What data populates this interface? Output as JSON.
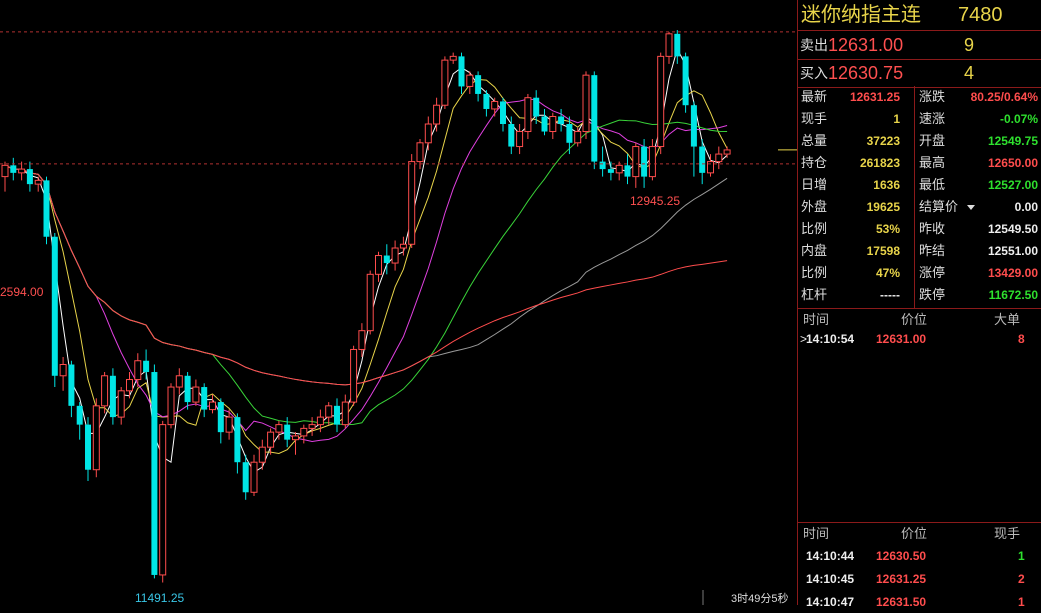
{
  "colors": {
    "up": "#ff4d4d",
    "down": "#00e5e5",
    "accent": "#e8d44a",
    "border": "#8b1a1a"
  },
  "header": {
    "name": "迷你纳指主连",
    "code": "7480"
  },
  "orderbook": {
    "sell": {
      "label": "卖出",
      "price": "12631.00",
      "volume": "9"
    },
    "buy": {
      "label": "买入",
      "price": "12630.75",
      "volume": "4"
    }
  },
  "quote_rows": [
    {
      "k1": "最新",
      "v1": "12631.25",
      "c1": "red",
      "k2": "涨跌",
      "v2": "80.25/0.64%",
      "c2": "red"
    },
    {
      "k1": "现手",
      "v1": "1",
      "c1": "yel",
      "k2": "速涨",
      "v2": "-0.07%",
      "c2": "grn"
    },
    {
      "k1": "总量",
      "v1": "37223",
      "c1": "yel",
      "k2": "开盘",
      "v2": "12549.75",
      "c2": "grn"
    },
    {
      "k1": "持仓",
      "v1": "261823",
      "c1": "yel",
      "k2": "最高",
      "v2": "12650.00",
      "c2": "red"
    },
    {
      "k1": "日增",
      "v1": "1636",
      "c1": "yel",
      "k2": "最低",
      "v2": "12527.00",
      "c2": "grn"
    },
    {
      "k1": "外盘",
      "v1": "19625",
      "c1": "yel",
      "k2": "结算价",
      "v2": "0.00",
      "c2": "wht"
    },
    {
      "k1": "比例",
      "v1": "53%",
      "c1": "yel",
      "k2": "昨收",
      "v2": "12549.50",
      "c2": "wht"
    },
    {
      "k1": "内盘",
      "v1": "17598",
      "c1": "yel",
      "k2": "昨结",
      "v2": "12551.00",
      "c2": "wht"
    },
    {
      "k1": "比例",
      "v1": "47%",
      "c1": "yel",
      "k2": "涨停",
      "v2": "13429.00",
      "c2": "red"
    },
    {
      "k1": "杠杆",
      "v1": "-----",
      "c1": "wht",
      "k2": "跌停",
      "v2": "11672.50",
      "c2": "grn"
    }
  ],
  "big_orders": {
    "headers": [
      "时间",
      "价位",
      "大单"
    ],
    "rows": [
      {
        "time": "14:10:54",
        "price": "12631.00",
        "volume": "8"
      }
    ]
  },
  "trades": {
    "headers": [
      "时间",
      "价位",
      "现手"
    ],
    "rows": [
      {
        "time": "14:10:44",
        "price": "12630.50",
        "volume": "1",
        "vc": "grn"
      },
      {
        "time": "14:10:45",
        "price": "12631.25",
        "volume": "2",
        "vc": "red"
      },
      {
        "time": "14:10:47",
        "price": "12631.50",
        "volume": "1",
        "vc": "red"
      }
    ]
  },
  "chart_data": {
    "type": "candlestick",
    "title": "",
    "ylim": [
      11420,
      13030
    ],
    "price_lines": [
      12945.25,
      12594.0
    ],
    "annotations": {
      "high_label": "12945.25",
      "left_label": "2594.00",
      "low_label": "11491.25",
      "countdown": "3时49分5秒"
    },
    "candles": [
      [
        12560,
        12590,
        12520,
        12600
      ],
      [
        12590,
        12570,
        12550,
        12610
      ],
      [
        12570,
        12580,
        12550,
        12600
      ],
      [
        12580,
        12540,
        12520,
        12600
      ],
      [
        12540,
        12550,
        12520,
        12560
      ],
      [
        12550,
        12400,
        12380,
        12560
      ],
      [
        12400,
        12030,
        12000,
        12410
      ],
      [
        12030,
        12060,
        11990,
        12080
      ],
      [
        12060,
        11950,
        11920,
        12070
      ],
      [
        11950,
        11900,
        11860,
        11960
      ],
      [
        11900,
        11780,
        11750,
        11920
      ],
      [
        11780,
        11950,
        11760,
        11970
      ],
      [
        11950,
        12030,
        11930,
        12040
      ],
      [
        12030,
        11920,
        11900,
        12050
      ],
      [
        11920,
        11990,
        11900,
        12000
      ],
      [
        11990,
        12020,
        11970,
        12040
      ],
      [
        12020,
        12070,
        12000,
        12090
      ],
      [
        12070,
        12040,
        12020,
        12100
      ],
      [
        12040,
        11500,
        11491,
        12060
      ],
      [
        11500,
        11900,
        11480,
        11910
      ],
      [
        11900,
        12000,
        11890,
        12010
      ],
      [
        12000,
        12030,
        11980,
        12050
      ],
      [
        12030,
        11960,
        11940,
        12040
      ],
      [
        11960,
        12000,
        11950,
        12020
      ],
      [
        12000,
        11940,
        11920,
        12010
      ],
      [
        11940,
        11960,
        11930,
        11980
      ],
      [
        11960,
        11880,
        11850,
        11970
      ],
      [
        11880,
        11920,
        11860,
        11940
      ],
      [
        11920,
        11800,
        11770,
        11930
      ],
      [
        11800,
        11720,
        11700,
        11820
      ],
      [
        11720,
        11800,
        11710,
        11820
      ],
      [
        11800,
        11840,
        11780,
        11860
      ],
      [
        11840,
        11880,
        11820,
        11890
      ],
      [
        11880,
        11900,
        11860,
        11910
      ],
      [
        11900,
        11860,
        11840,
        11920
      ],
      [
        11860,
        11870,
        11820,
        11880
      ],
      [
        11870,
        11890,
        11850,
        11900
      ],
      [
        11890,
        11900,
        11870,
        11920
      ],
      [
        11900,
        11920,
        11880,
        11940
      ],
      [
        11920,
        11950,
        11900,
        11960
      ],
      [
        11950,
        11900,
        11880,
        11970
      ],
      [
        11900,
        11960,
        11890,
        11980
      ],
      [
        11960,
        12100,
        11950,
        12110
      ],
      [
        12100,
        12150,
        12080,
        12170
      ],
      [
        12150,
        12300,
        12140,
        12310
      ],
      [
        12300,
        12350,
        12280,
        12360
      ],
      [
        12350,
        12330,
        12300,
        12380
      ],
      [
        12330,
        12370,
        12310,
        12390
      ],
      [
        12370,
        12380,
        12350,
        12400
      ],
      [
        12380,
        12600,
        12370,
        12620
      ],
      [
        12600,
        12650,
        12580,
        12660
      ],
      [
        12650,
        12700,
        12630,
        12720
      ],
      [
        12700,
        12750,
        12680,
        12770
      ],
      [
        12750,
        12870,
        12740,
        12880
      ],
      [
        12870,
        12880,
        12860,
        12890
      ],
      [
        12880,
        12800,
        12780,
        12890
      ],
      [
        12800,
        12830,
        12780,
        12840
      ],
      [
        12830,
        12780,
        12760,
        12840
      ],
      [
        12780,
        12740,
        12720,
        12790
      ],
      [
        12740,
        12760,
        12720,
        12770
      ],
      [
        12760,
        12700,
        12680,
        12770
      ],
      [
        12700,
        12640,
        12620,
        12720
      ],
      [
        12640,
        12680,
        12620,
        12700
      ],
      [
        12680,
        12770,
        12660,
        12780
      ],
      [
        12770,
        12720,
        12700,
        12790
      ],
      [
        12720,
        12680,
        12670,
        12740
      ],
      [
        12680,
        12720,
        12660,
        12730
      ],
      [
        12720,
        12700,
        12680,
        12740
      ],
      [
        12700,
        12650,
        12620,
        12720
      ],
      [
        12650,
        12680,
        12640,
        12690
      ],
      [
        12680,
        12830,
        12660,
        12840
      ],
      [
        12830,
        12600,
        12580,
        12840
      ],
      [
        12600,
        12580,
        12560,
        12640
      ],
      [
        12580,
        12570,
        12550,
        12600
      ],
      [
        12570,
        12590,
        12550,
        12600
      ],
      [
        12590,
        12560,
        12540,
        12620
      ],
      [
        12560,
        12640,
        12530,
        12650
      ],
      [
        12640,
        12560,
        12530,
        12660
      ],
      [
        12560,
        12640,
        12550,
        12660
      ],
      [
        12640,
        12880,
        12620,
        12890
      ],
      [
        12880,
        12940,
        12860,
        12945
      ],
      [
        12940,
        12880,
        12860,
        12950
      ],
      [
        12880,
        12750,
        12730,
        12890
      ],
      [
        12750,
        12640,
        12560,
        12760
      ],
      [
        12640,
        12570,
        12540,
        12660
      ],
      [
        12570,
        12600,
        12560,
        12620
      ],
      [
        12600,
        12620,
        12580,
        12640
      ],
      [
        12620,
        12631,
        12610,
        12640
      ]
    ]
  }
}
